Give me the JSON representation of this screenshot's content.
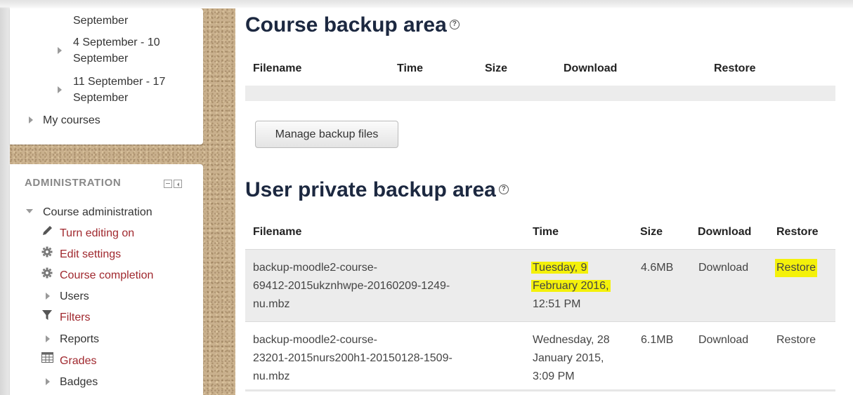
{
  "sidebar": {
    "nav_items": [
      {
        "label": "September"
      },
      {
        "label_line1": "4 September - 10",
        "label_line2": "September"
      },
      {
        "label_line1": "11 September - 17",
        "label_line2": "September"
      },
      {
        "label": "My courses"
      }
    ],
    "admin": {
      "title": "ADMINISTRATION",
      "course_admin": "Course administration",
      "items": [
        {
          "label": "Turn editing on",
          "icon": "pencil-icon"
        },
        {
          "label": "Edit settings",
          "icon": "gear-icon"
        },
        {
          "label": "Course completion",
          "icon": "gear-icon"
        },
        {
          "label": "Users",
          "icon": "triangle-right-icon"
        },
        {
          "label": "Filters",
          "icon": "filter-icon"
        },
        {
          "label": "Reports",
          "icon": "triangle-right-icon"
        },
        {
          "label": "Grades",
          "icon": "table-icon"
        },
        {
          "label": "Badges",
          "icon": "triangle-right-icon"
        }
      ]
    }
  },
  "course_backup": {
    "title": "Course backup area",
    "columns": [
      "Filename",
      "Time",
      "Size",
      "Download",
      "Restore"
    ],
    "manage_button": "Manage backup files"
  },
  "user_backup": {
    "title": "User private backup area",
    "columns": [
      "Filename",
      "Time",
      "Size",
      "Download",
      "Restore"
    ],
    "rows": [
      {
        "filename_lines": [
          "backup-moodle2-course-",
          "69412-2015ukznhwpe-20160209-1249-",
          "nu.mbz"
        ],
        "time_lines": [
          "Tuesday, 9",
          "February 2016,",
          "12:51 PM"
        ],
        "size": "4.6MB",
        "download": "Download",
        "restore": "Restore"
      },
      {
        "filename_lines": [
          "backup-moodle2-course-",
          "23201-2015nurs200h1-20150128-1509-",
          "nu.mbz"
        ],
        "time_lines": [
          "Wednesday, 28",
          "January 2015,",
          "3:09 PM"
        ],
        "size": "6.1MB",
        "download": "Download",
        "restore": "Restore"
      }
    ]
  },
  "colors": {
    "link": "#a0282e",
    "heading": "#1c2840",
    "highlight": "#f4f10a"
  }
}
